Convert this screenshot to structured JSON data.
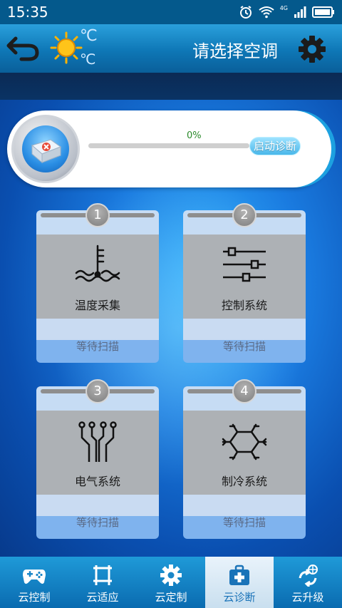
{
  "status_bar": {
    "time": "15:35",
    "network": "4G"
  },
  "header": {
    "title": "请选择空调",
    "temp_unit_top": "℃",
    "temp_unit_bottom": "℃",
    "icons": [
      "back-arrow-icon",
      "sun-icon",
      "gear-icon"
    ]
  },
  "diagnosis": {
    "progress_text": "0%",
    "progress_fraction": 0,
    "start_button_label": "启动诊断",
    "icon": "medical-kit-icon"
  },
  "cards": [
    {
      "number": "1",
      "label": "温度采集",
      "status": "等待扫描",
      "icon": "temperature-sensor-icon"
    },
    {
      "number": "2",
      "label": "控制系统",
      "status": "等待扫描",
      "icon": "sliders-icon"
    },
    {
      "number": "3",
      "label": "电气系统",
      "status": "等待扫描",
      "icon": "circuit-icon"
    },
    {
      "number": "4",
      "label": "制冷系统",
      "status": "等待扫描",
      "icon": "snowflake-icon"
    }
  ],
  "bottom_nav": {
    "active_index": 3,
    "items": [
      {
        "label": "云控制",
        "icon": "gamepad-icon"
      },
      {
        "label": "云适应",
        "icon": "crop-frame-icon"
      },
      {
        "label": "云定制",
        "icon": "gear-icon"
      },
      {
        "label": "云诊断",
        "icon": "medical-case-icon"
      },
      {
        "label": "云升级",
        "icon": "cloud-upgrade-icon"
      }
    ]
  },
  "colors": {
    "header_blue": "#0e77b6",
    "accent_green": "#2b8a2b",
    "nav_active_text": "#1a73b8"
  }
}
